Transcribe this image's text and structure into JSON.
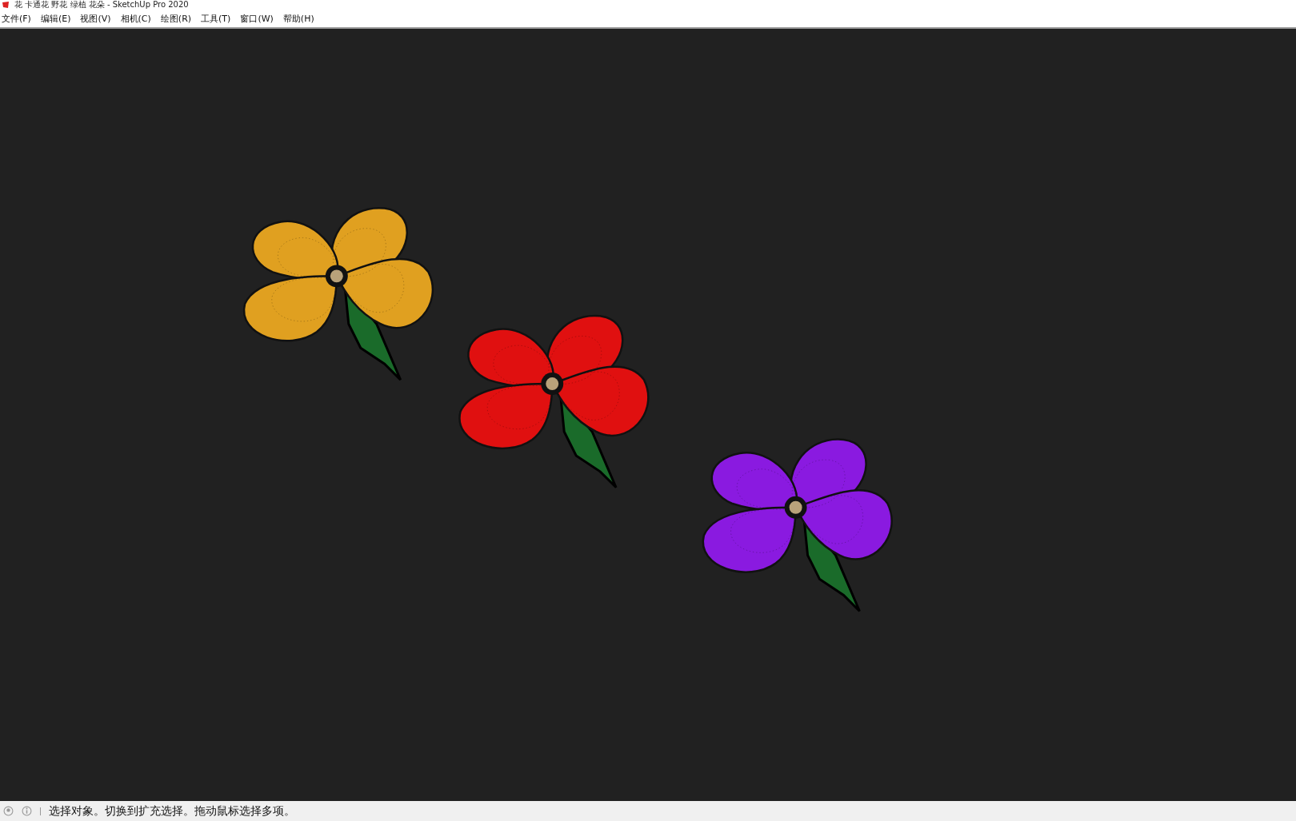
{
  "window": {
    "title": "花 卡通花 野花 绿植 花朵 - SketchUp Pro 2020"
  },
  "menu": [
    "文件(F)",
    "编辑(E)",
    "视图(V)",
    "相机(C)",
    "绘图(R)",
    "工具(T)",
    "窗口(W)",
    "帮助(H)"
  ],
  "flowers": [
    {
      "color": "#e0a020"
    },
    {
      "color": "#e01010"
    },
    {
      "color": "#8a1ae0"
    }
  ],
  "status_bar": {
    "message": "选择对象。切换到扩充选择。拖动鼠标选择多项。"
  }
}
